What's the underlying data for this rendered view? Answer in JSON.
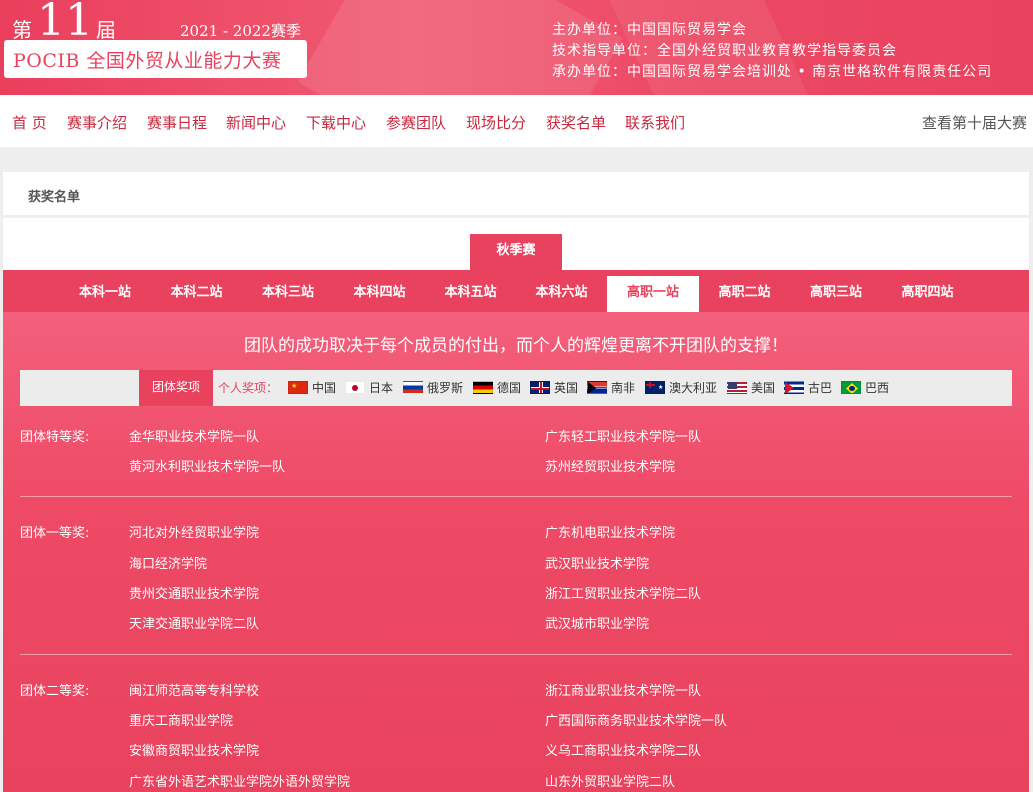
{
  "header": {
    "edition_prefix": "第",
    "edition_number": "11",
    "edition_suffix": "届",
    "season": "2021 - 2022赛季",
    "competition_title": "POCIB 全国外贸从业能力大赛",
    "organizers": [
      "主办单位：中国国际贸易学会",
      "技术指导单位：全国外经贸职业教育教学指导委员会",
      "承办单位：中国国际贸易学会培训处 • 南京世格软件有限责任公司"
    ]
  },
  "nav": {
    "items": [
      "首 页",
      "赛事介绍",
      "赛事日程",
      "新闻中心",
      "下载中心",
      "参赛团队",
      "现场比分",
      "获奖名单",
      "联系我们"
    ],
    "right_link": "查看第十届大赛"
  },
  "breadcrumb": "获奖名单",
  "season_tab": "秋季赛",
  "stage_tabs": {
    "items": [
      "本科一站",
      "本科二站",
      "本科三站",
      "本科四站",
      "本科五站",
      "本科六站",
      "高职一站",
      "高职二站",
      "高职三站",
      "高职四站"
    ],
    "active": "高职一站"
  },
  "motto": "团队的成功取决于每个成员的付出，而个人的辉煌更离不开团队的支撑！",
  "filter": {
    "team_awards": "团体奖项",
    "individual_label": "个人奖项：",
    "countries": [
      {
        "name": "中国",
        "flag": "china-flag"
      },
      {
        "name": "日本",
        "flag": "japan-flag"
      },
      {
        "name": "俄罗斯",
        "flag": "russia-flag"
      },
      {
        "name": "德国",
        "flag": "germany-flag"
      },
      {
        "name": "英国",
        "flag": "uk-flag"
      },
      {
        "name": "南非",
        "flag": "south-africa-flag"
      },
      {
        "name": "澳大利亚",
        "flag": "australia-flag"
      },
      {
        "name": "美国",
        "flag": "usa-flag"
      },
      {
        "name": "古巴",
        "flag": "cuba-flag"
      },
      {
        "name": "巴西",
        "flag": "brazil-flag"
      }
    ]
  },
  "awards": [
    {
      "label": "团体特等奖:",
      "left": [
        "金华职业技术学院一队",
        "黄河水利职业技术学院一队"
      ],
      "right": [
        "广东轻工职业技术学院一队",
        "苏州经贸职业技术学院"
      ]
    },
    {
      "label": "团体一等奖:",
      "left": [
        "河北对外经贸职业学院",
        "海口经济学院",
        "贵州交通职业技术学院",
        "天津交通职业学院二队"
      ],
      "right": [
        "广东机电职业技术学院",
        "武汉职业技术学院",
        "浙江工贸职业技术学院二队",
        "武汉城市职业学院"
      ]
    },
    {
      "label": "团体二等奖:",
      "left": [
        "闽江师范高等专科学校",
        "重庆工商职业学院",
        "安徽商贸职业技术学院",
        "广东省外语艺术职业学院外语外贸学院"
      ],
      "right": [
        "浙江商业职业技术学院一队",
        "广西国际商务职业技术学院一队",
        "义乌工商职业技术学院二队",
        "山东外贸职业学院二队"
      ]
    }
  ],
  "colors": {
    "brand_red": "#e8425e",
    "nav_text": "#c8283e",
    "page_bg": "#eeeeee"
  }
}
